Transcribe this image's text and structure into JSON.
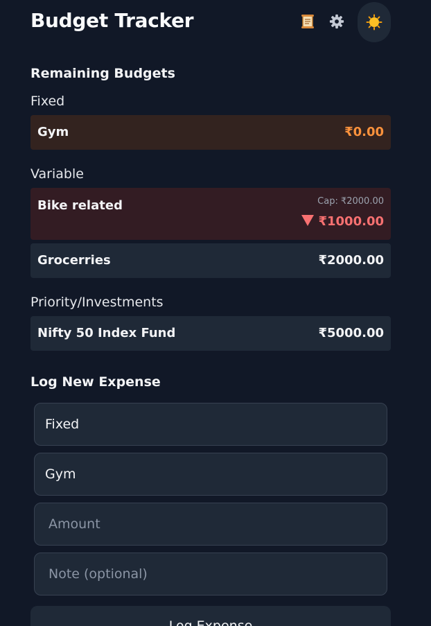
{
  "header": {
    "title": "Budget Tracker",
    "icons": {
      "log": "scroll-icon",
      "settings": "gear-icon",
      "theme": "sun-icon"
    }
  },
  "remaining": {
    "title": "Remaining Budgets",
    "groups": {
      "fixed": {
        "label": "Fixed",
        "items": [
          {
            "name": "Gym",
            "amount": "₹0.00"
          }
        ]
      },
      "variable": {
        "label": "Variable",
        "items": [
          {
            "name": "Bike related",
            "cap": "Cap: ₹2000.00",
            "amount": "₹1000.00"
          },
          {
            "name": "Grocerries",
            "amount": "₹2000.00"
          }
        ]
      },
      "priority": {
        "label": "Priority/Investments",
        "items": [
          {
            "name": "Nifty 50 Index Fund",
            "amount": "₹5000.00"
          }
        ]
      }
    }
  },
  "log": {
    "title": "Log New Expense",
    "type_value": "Fixed",
    "category_value": "Gym",
    "amount_placeholder": "Amount",
    "note_placeholder": "Note (optional)",
    "submit_label": "Log Expense"
  },
  "colors": {
    "background": "#111827",
    "card": "#1f2937",
    "warning": "#fb923c",
    "danger": "#f87171"
  }
}
